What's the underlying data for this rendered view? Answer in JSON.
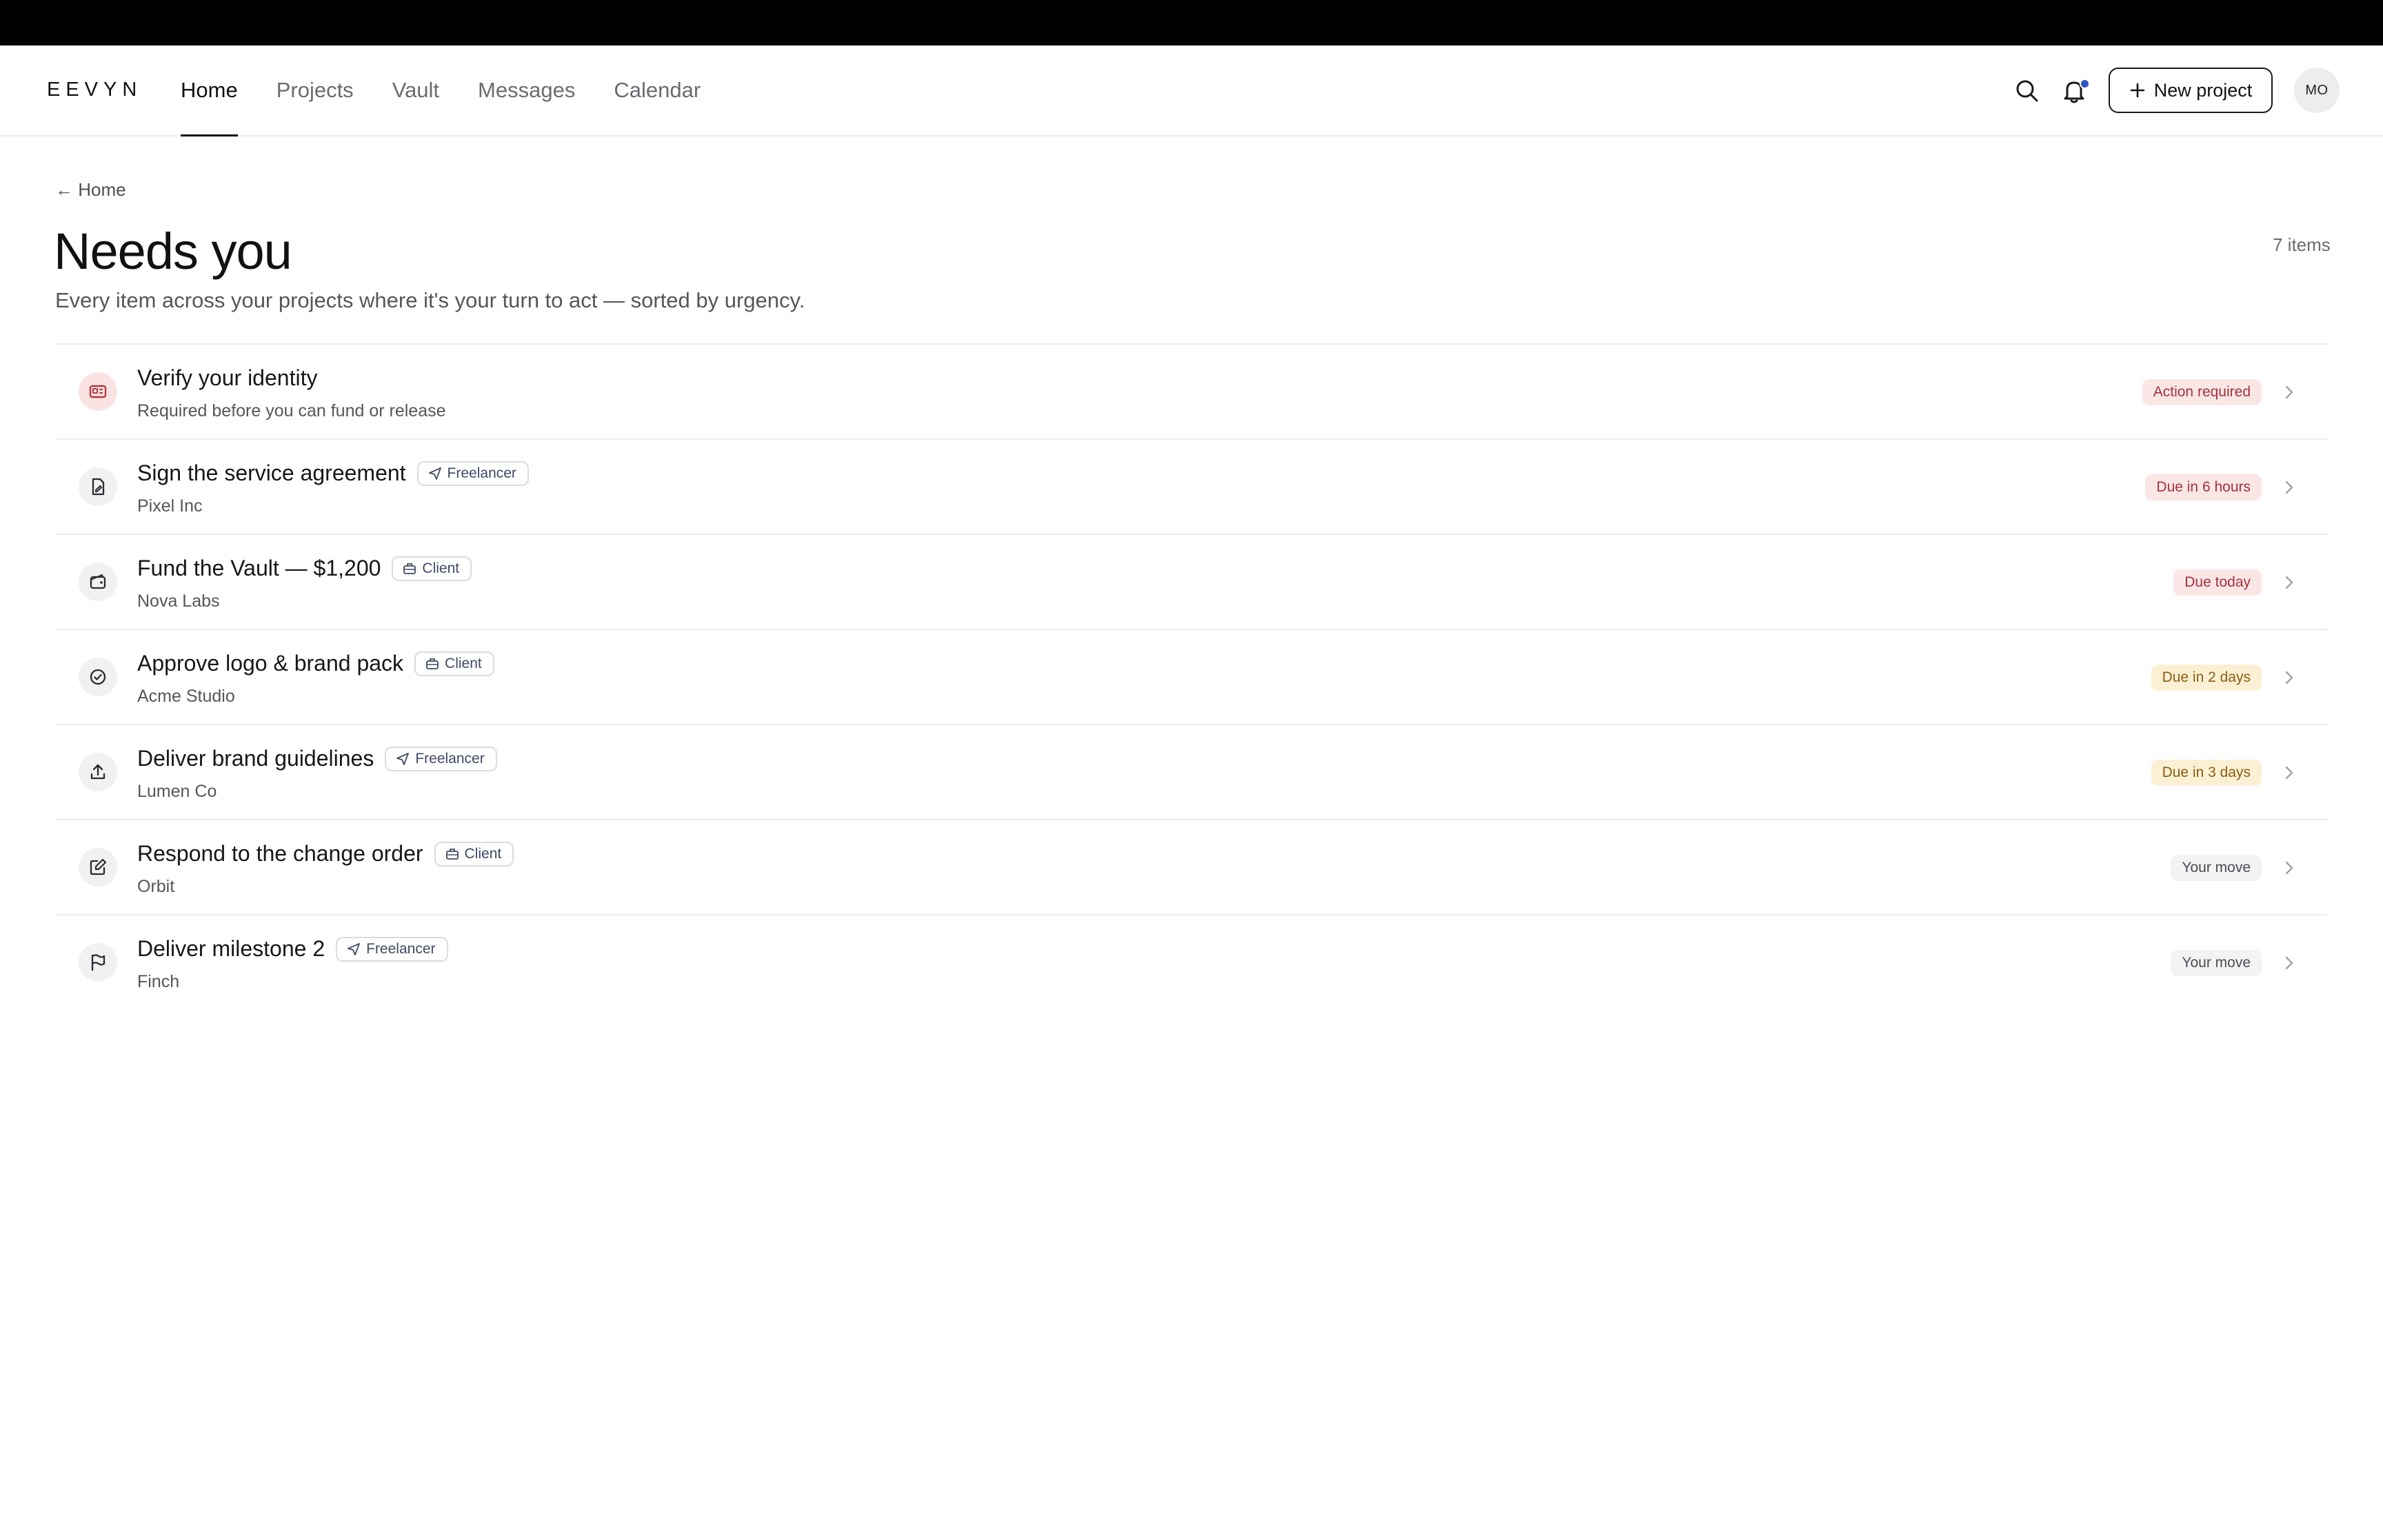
{
  "app": {
    "logo": "EEVYN"
  },
  "nav": {
    "items": [
      {
        "label": "Home",
        "active": true
      },
      {
        "label": "Projects"
      },
      {
        "label": "Vault"
      },
      {
        "label": "Messages"
      },
      {
        "label": "Calendar"
      }
    ]
  },
  "header": {
    "search_icon": "search-icon",
    "notification_icon": "bell-icon",
    "new_project_label": "New project",
    "avatar_initials": "MO"
  },
  "page": {
    "back_label": "Home",
    "title": "Needs you",
    "subtitle": "Every item across your projects where it's your turn to act — sorted by urgency.",
    "count": "7 items"
  },
  "colors": {
    "accent_dot": "#2f55c7",
    "status_red": "#a2343a",
    "status_amber": "#8a5d12"
  },
  "items": [
    {
      "title": "Verify your identity",
      "sub": "Required before you can fund or release",
      "role": "",
      "status": "Action required",
      "tone": "red",
      "icon": "id-card-icon"
    },
    {
      "title": "Sign the service agreement",
      "sub": "Pixel Inc",
      "role": "Freelancer",
      "status": "Due in 6 hours",
      "tone": "red",
      "icon": "signature-icon"
    },
    {
      "title": "Fund the Vault — $1,200",
      "sub": "Nova Labs",
      "role": "Client",
      "status": "Due today",
      "tone": "red",
      "icon": "wallet-icon"
    },
    {
      "title": "Approve logo & brand pack",
      "sub": "Acme Studio",
      "role": "Client",
      "status": "Due in 2 days",
      "tone": "amber",
      "icon": "check-circle-icon"
    },
    {
      "title": "Deliver brand guidelines",
      "sub": "Lumen Co",
      "role": "Freelancer",
      "status": "Due in 3 days",
      "tone": "amber",
      "icon": "upload-icon"
    },
    {
      "title": "Respond to the change order",
      "sub": "Orbit",
      "role": "Client",
      "status": "Your move",
      "tone": "gray",
      "icon": "edit-icon"
    },
    {
      "title": "Deliver milestone 2",
      "sub": "Finch",
      "role": "Freelancer",
      "status": "Your move",
      "tone": "gray",
      "icon": "flag-icon"
    }
  ]
}
